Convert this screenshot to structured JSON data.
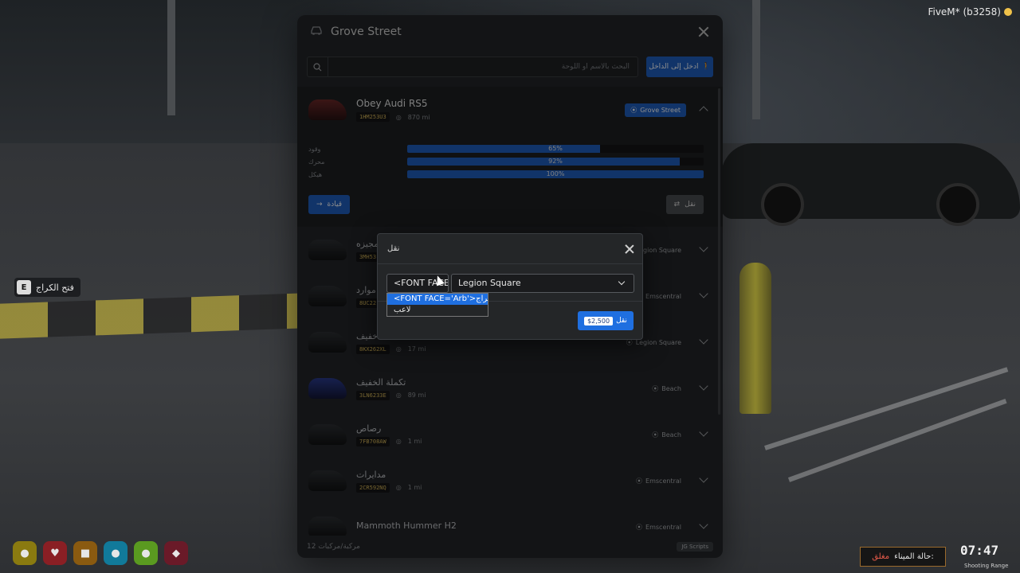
{
  "hud": {
    "fivem_label": "FiveM* (b3258)",
    "garage_hint_key": "E",
    "garage_hint_text": "فتح الكراج",
    "port_label": "حالة الميناء:",
    "port_status": "مغلق",
    "clock_time": "07:47",
    "clock_sub": "Shooting Range"
  },
  "panel": {
    "title": "Grove Street",
    "search_placeholder": "البحث بالاسم أو اللوحة",
    "enter_button": "ادخل إلى الداخل",
    "footer_count": "مركبة/مركبات 12",
    "footer_brand": "JG Scripts"
  },
  "expanded_vehicle": {
    "name": "Obey Audi RS5",
    "plate": "1HM253U3",
    "mileage": "870 mi",
    "location": "Grove Street",
    "stats": [
      {
        "label": "وقود",
        "percent": 65,
        "text": "65%"
      },
      {
        "label": "محرك",
        "percent": 92,
        "text": "92%"
      },
      {
        "label": "هيكل",
        "percent": 100,
        "text": "100%"
      }
    ],
    "drive_button": "قيادة",
    "transfer_button": "نقل"
  },
  "vehicles": [
    {
      "name": "المجيزه",
      "plate": "3MH53",
      "mileage": "",
      "location": "Legion Square",
      "thumb": "dark"
    },
    {
      "name": "موارد",
      "plate": "8UC22",
      "mileage": "",
      "location": "Emscentral",
      "thumb": "dark"
    },
    {
      "name": "خفيف",
      "plate": "8KX262XL",
      "mileage": "17 mi",
      "location": "Legion Square",
      "thumb": "dark"
    },
    {
      "name": "تكملة الخفيف",
      "plate": "3LN6233E",
      "mileage": "89 mi",
      "location": "Beach",
      "thumb": "blue"
    },
    {
      "name": "رصاص",
      "plate": "7FB708AW",
      "mileage": "1 mi",
      "location": "Beach",
      "thumb": "dark"
    },
    {
      "name": "مدايرات",
      "plate": "2CR592NQ",
      "mileage": "1 mi",
      "location": "Emscentral",
      "thumb": "dark"
    },
    {
      "name": "Mammoth Hummer H2",
      "plate": "",
      "mileage": "",
      "location": "Emscentral",
      "thumb": "dark"
    }
  ],
  "modal": {
    "title": "نقل",
    "type_value": "<FONT FACE='Arb'>",
    "location_value": "Legion Square",
    "options": [
      "<FONT FACE='Arb'>كراج",
      "لاعب"
    ],
    "transfer_label": "نقل",
    "price": "$2,500"
  },
  "colors": {
    "accent": "#1f5fc0",
    "panel_bg": "#242628",
    "plate_text": "#d9b85a"
  }
}
